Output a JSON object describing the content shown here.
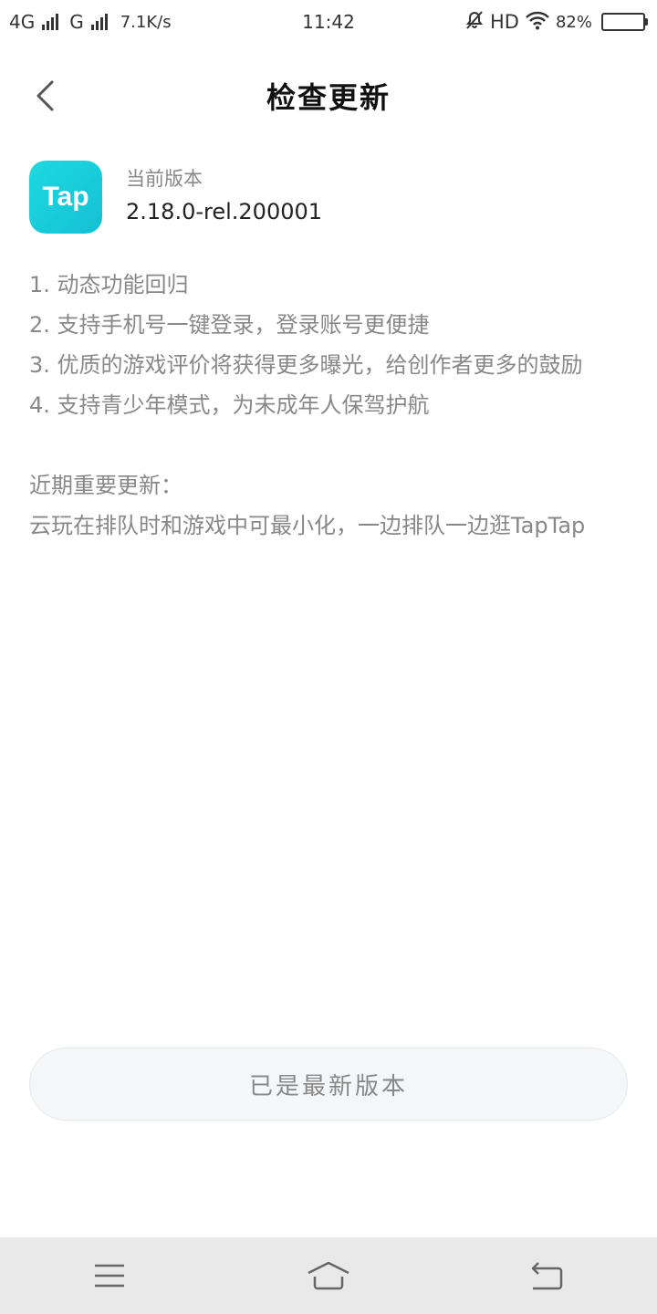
{
  "status_bar": {
    "network_1": "4G",
    "network_2": "G",
    "net_speed": "7.1K/s",
    "time": "11:42",
    "hd": "HD",
    "battery_text": "82%",
    "battery_level": 0.82
  },
  "header": {
    "title": "检查更新"
  },
  "app": {
    "logo_text": "Tap",
    "logo_color": "#1ed9e0",
    "version_label": "当前版本",
    "version_value": "2.18.0-rel.200001"
  },
  "notes": {
    "items": [
      "1. 动态功能回归",
      "2. 支持手机号一键登录，登录账号更便捷",
      "3. 优质的游戏评价将获得更多曝光，给创作者更多的鼓励",
      "4. 支持青少年模式，为未成年人保驾护航"
    ],
    "recent_title": "近期重要更新：",
    "recent_body": "云玩在排队时和游戏中可最小化，一边排队一边逛TapTap"
  },
  "button": {
    "label": "已是最新版本"
  },
  "nav": {
    "menu_icon": "menu-icon",
    "home_icon": "home-icon",
    "back_icon": "back-icon"
  }
}
